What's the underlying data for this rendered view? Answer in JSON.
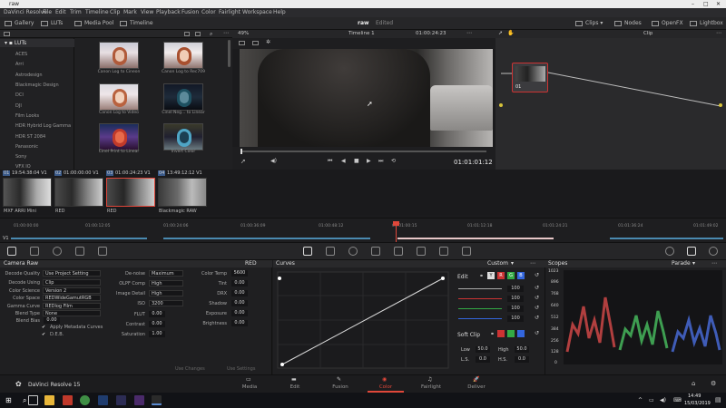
{
  "titlebar": {
    "title": "raw"
  },
  "menu": [
    "DaVinci Resolve",
    "File",
    "Edit",
    "Trim",
    "Timeline",
    "Clip",
    "Mark",
    "View",
    "Playback",
    "Fusion",
    "Color",
    "Fairlight",
    "Workspace",
    "Help"
  ],
  "topbar": {
    "gallery": "Gallery",
    "luts": "LUTs",
    "media_pool": "Media Pool",
    "timeline": "Timeline",
    "project": "raw",
    "edited": "Edited",
    "clips": "Clips",
    "nodes": "Nodes",
    "openfx": "OpenFX",
    "lightbox": "Lightbox"
  },
  "lutbar": {
    "zoom": "49%",
    "timeline_name": "Timeline 1",
    "timecode": "01:00:24:23",
    "clip_label": "Clip"
  },
  "tree": {
    "root": "LUTs",
    "items": [
      "ACES",
      "Arri",
      "Astrodesign",
      "Blackmagic Design",
      "DCI",
      "DJI",
      "Film Looks",
      "HDR Hybrid Log Gamma",
      "HDR ST 2084",
      "Panasonic",
      "Sony",
      "VFX IO"
    ]
  },
  "thumbs": [
    {
      "label": "Canon Log to Cineon"
    },
    {
      "label": "Canon Log to Rec709"
    },
    {
      "label": "Canon Log to Video"
    },
    {
      "label": "Cinel Neg... to Linear"
    },
    {
      "label": "Cinel Print to Linear"
    },
    {
      "label": "Invert Color"
    }
  ],
  "viewer": {
    "timecode": "01:01:01:12"
  },
  "node": {
    "label": "01"
  },
  "clips": [
    {
      "num": "01",
      "tc": "19:54:38:04",
      "track": "V1",
      "name": "MXF ARRI Mini"
    },
    {
      "num": "02",
      "tc": "01:00:00:00",
      "track": "V1",
      "name": "RED"
    },
    {
      "num": "03",
      "tc": "01:00:24:23",
      "track": "V1",
      "name": "RED"
    },
    {
      "num": "04",
      "tc": "13:49:12:12",
      "track": "V1",
      "name": "Blackmagic RAW"
    }
  ],
  "timeline": {
    "track": "V1",
    "ticks": [
      "01:00:00:00",
      "01:00:12:05",
      "01:00:24:06",
      "01:00:36:09",
      "01:00:48:12",
      "01:01:00:15",
      "01:01:12:18",
      "01:01:24:21",
      "01:01:36:24",
      "01:01:49:02"
    ]
  },
  "camraw": {
    "title": "Camera Raw",
    "source": "RED",
    "fields": [
      {
        "label": "Decode Quality",
        "value": "Use Project Setting"
      },
      {
        "label": "Decode Using",
        "value": "Clip"
      },
      {
        "label": "Color Science",
        "value": "Version 2"
      },
      {
        "label": "Color Space",
        "value": "REDWideGamutRGB"
      },
      {
        "label": "Gamma Curve",
        "value": "REDlog Film"
      },
      {
        "label": "Blend Type",
        "value": "None"
      },
      {
        "label": "Blend Bias",
        "value": "0.00"
      }
    ],
    "apply_metadata": "Apply Metadata Curves",
    "deb": "D.E.B.",
    "mid": [
      {
        "label": "De-noise",
        "value": "Maximum"
      },
      {
        "label": "OLPF Comp",
        "value": "High"
      },
      {
        "label": "Image Detail",
        "value": "High"
      },
      {
        "label": "ISO",
        "value": "3200"
      },
      {
        "label": "FLUT",
        "value": "0.00"
      },
      {
        "label": "Contrast",
        "value": "0.00"
      },
      {
        "label": "Saturation",
        "value": "1.00"
      }
    ],
    "right": [
      {
        "label": "Color Temp",
        "value": "5600"
      },
      {
        "label": "Tint",
        "value": "0.00"
      },
      {
        "label": "DRX",
        "value": "0.00"
      },
      {
        "label": "Shadow",
        "value": "0.00"
      },
      {
        "label": "Exposure",
        "value": "0.00"
      },
      {
        "label": "Brightness",
        "value": "0.00"
      }
    ],
    "use_changes": "Use Changes",
    "use_settings": "Use Settings"
  },
  "curves": {
    "title": "Curves",
    "mode": "Custom",
    "edit": "Edit",
    "channels": [
      "Y",
      "R",
      "G",
      "B"
    ],
    "values": [
      "100",
      "100",
      "100",
      "100"
    ],
    "soft_clip": "Soft Clip",
    "low_label": "Low",
    "low": "50.0",
    "high_label": "High",
    "high": "50.0",
    "ls_label": "L.S.",
    "ls": "0.0",
    "hs_label": "H.S.",
    "hs": "0.0"
  },
  "scopes": {
    "title": "Scopes",
    "mode": "Parade",
    "ticks": [
      "1023",
      "896",
      "768",
      "640",
      "512",
      "384",
      "256",
      "128",
      "0"
    ]
  },
  "pages": {
    "app": "DaVinci Resolve 15",
    "items": [
      "Media",
      "Edit",
      "Fusion",
      "Color",
      "Fairlight",
      "Deliver"
    ],
    "active": "Color"
  },
  "taskbar": {
    "time": "14:49",
    "date": "15/03/2019"
  },
  "colors": {
    "accent": "#e0473a",
    "panel": "#1f1f21",
    "red": "#cc3333",
    "green": "#33aa44",
    "blue": "#3366dd"
  }
}
